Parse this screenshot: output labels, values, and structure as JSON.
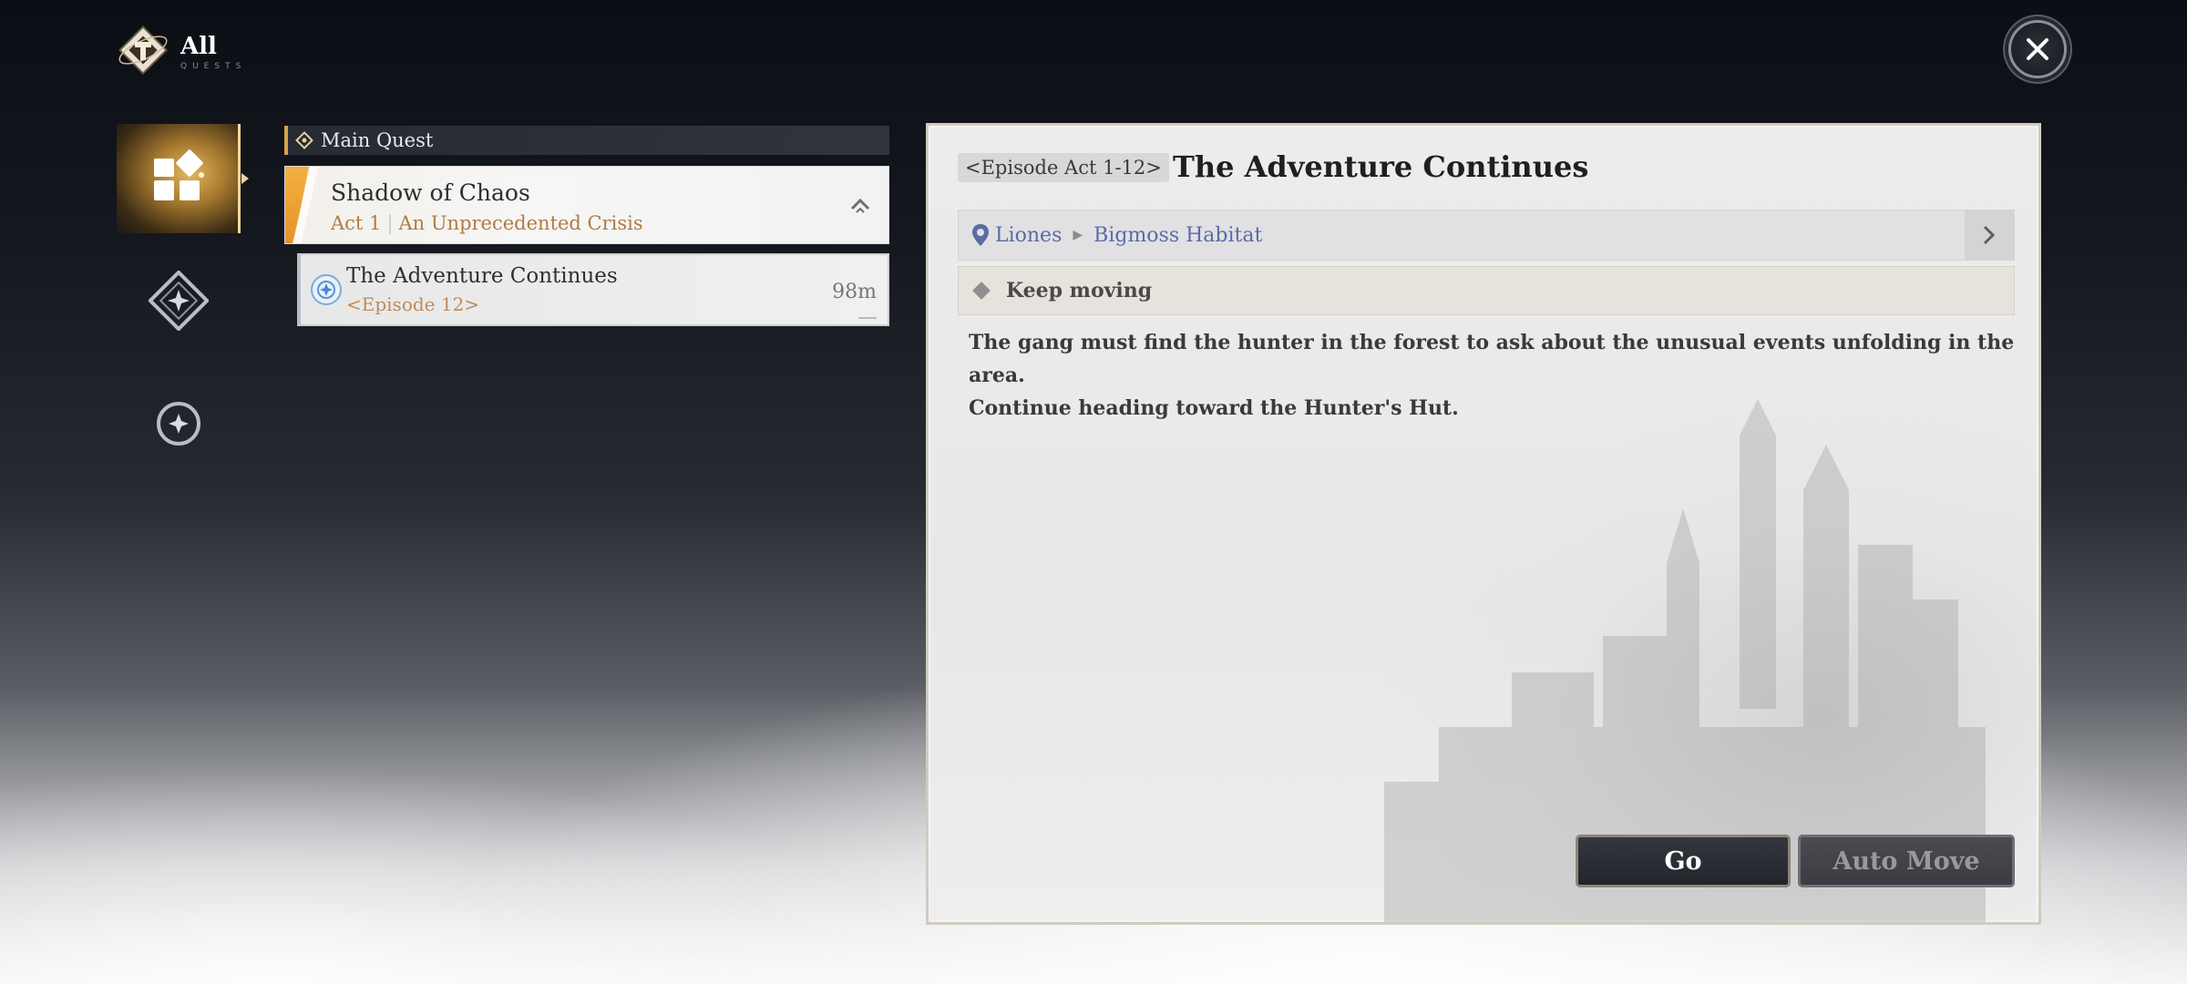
{
  "header": {
    "title": "All",
    "subtitle": "QUESTS"
  },
  "categories": [
    {
      "icon": "all-quests-icon",
      "active": true
    },
    {
      "icon": "diamond-star-icon",
      "active": false
    },
    {
      "icon": "compass-star-icon",
      "active": false
    }
  ],
  "quest_list": {
    "section_label": "Main Quest",
    "chapter": {
      "title": "Shadow of Chaos",
      "act": "Act 1",
      "act_name": "An Unprecedented Crisis"
    },
    "quests": [
      {
        "name": "The Adventure Continues",
        "episode": "<Episode 12>",
        "distance": "98m"
      }
    ]
  },
  "detail": {
    "episode_tag": "<Episode Act 1-12>",
    "title": "The Adventure Continues",
    "location": {
      "region": "Liones",
      "area": "Bigmoss Habitat"
    },
    "objective": "Keep moving",
    "description_line1": "The gang must find the hunter in the forest to ask about the unusual events unfolding in the area.",
    "description_line2": "Continue heading toward the Hunter's Hut.",
    "go_label": "Go",
    "auto_move_label": "Auto Move"
  },
  "colors": {
    "accent_gold": "#d5a24c",
    "location_blue": "#5a6ba6",
    "episode_brown": "#c08a58"
  }
}
